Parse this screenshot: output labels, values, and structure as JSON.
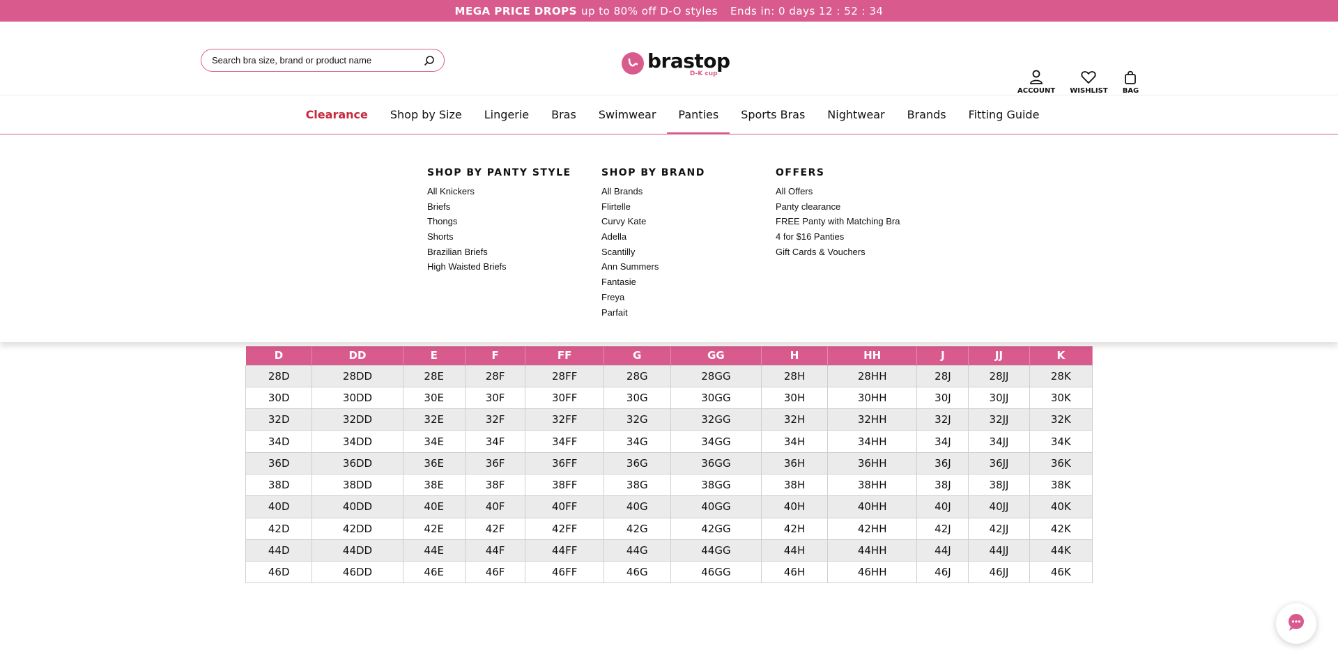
{
  "promo": {
    "bold": "MEGA PRICE DROPS",
    "text": "up to 80% off D-O styles",
    "ends": "Ends in: 0 days 12 : 52 : 34"
  },
  "search": {
    "placeholder": "Search bra size, brand or product name",
    "icon": "search-icon"
  },
  "logo": {
    "name": "brastop",
    "sub": "D-K cup"
  },
  "header_actions": [
    {
      "label": "ACCOUNT",
      "icon": "user-icon"
    },
    {
      "label": "WISHLIST",
      "icon": "heart-icon"
    },
    {
      "label": "BAG",
      "icon": "bag-icon"
    }
  ],
  "nav": {
    "active": "Panties",
    "items": [
      "Clearance",
      "Shop by Size",
      "Lingerie",
      "Bras",
      "Swimwear",
      "Panties",
      "Sports Bras",
      "Nightwear",
      "Brands",
      "Fitting Guide"
    ]
  },
  "mega_menu": [
    {
      "heading": "SHOP BY PANTY STYLE",
      "links": [
        "All Knickers",
        "Briefs",
        "Thongs",
        "Shorts",
        "Brazilian Briefs",
        "High Waisted Briefs"
      ]
    },
    {
      "heading": "SHOP BY BRAND",
      "links": [
        "All Brands",
        "Flirtelle",
        "Curvy Kate",
        "Adella",
        "Scantilly",
        "Ann Summers",
        "Fantasie",
        "Freya",
        "Parfait"
      ]
    },
    {
      "heading": "OFFERS",
      "links": [
        "All Offers",
        "Panty clearance",
        "FREE Panty with Matching Bra",
        "4 for $16 Panties",
        "Gift Cards & Vouchers"
      ]
    }
  ],
  "size_table": {
    "headers": [
      "D",
      "DD",
      "E",
      "F",
      "FF",
      "G",
      "GG",
      "H",
      "HH",
      "J",
      "JJ",
      "K"
    ],
    "rows": [
      [
        "28D",
        "28DD",
        "28E",
        "28F",
        "28FF",
        "28G",
        "28GG",
        "28H",
        "28HH",
        "28J",
        "28JJ",
        "28K"
      ],
      [
        "30D",
        "30DD",
        "30E",
        "30F",
        "30FF",
        "30G",
        "30GG",
        "30H",
        "30HH",
        "30J",
        "30JJ",
        "30K"
      ],
      [
        "32D",
        "32DD",
        "32E",
        "32F",
        "32FF",
        "32G",
        "32GG",
        "32H",
        "32HH",
        "32J",
        "32JJ",
        "32K"
      ],
      [
        "34D",
        "34DD",
        "34E",
        "34F",
        "34FF",
        "34G",
        "34GG",
        "34H",
        "34HH",
        "34J",
        "34JJ",
        "34K"
      ],
      [
        "36D",
        "36DD",
        "36E",
        "36F",
        "36FF",
        "36G",
        "36GG",
        "36H",
        "36HH",
        "36J",
        "36JJ",
        "36K"
      ],
      [
        "38D",
        "38DD",
        "38E",
        "38F",
        "38FF",
        "38G",
        "38GG",
        "38H",
        "38HH",
        "38J",
        "38JJ",
        "38K"
      ],
      [
        "40D",
        "40DD",
        "40E",
        "40F",
        "40FF",
        "40G",
        "40GG",
        "40H",
        "40HH",
        "40J",
        "40JJ",
        "40K"
      ],
      [
        "42D",
        "42DD",
        "42E",
        "42F",
        "42FF",
        "42G",
        "42GG",
        "42H",
        "42HH",
        "42J",
        "42JJ",
        "42K"
      ],
      [
        "44D",
        "44DD",
        "44E",
        "44F",
        "44FF",
        "44G",
        "44GG",
        "44H",
        "44HH",
        "44J",
        "44JJ",
        "44K"
      ],
      [
        "46D",
        "46DD",
        "46E",
        "46F",
        "46FF",
        "46G",
        "46GG",
        "46H",
        "46HH",
        "46J",
        "46JJ",
        "46K"
      ]
    ]
  },
  "chat": {
    "icon": "chat-icon"
  },
  "colors": {
    "brand": "#d95b8d",
    "clearance": "#c62a3b",
    "row_alt": "#ebebeb"
  }
}
